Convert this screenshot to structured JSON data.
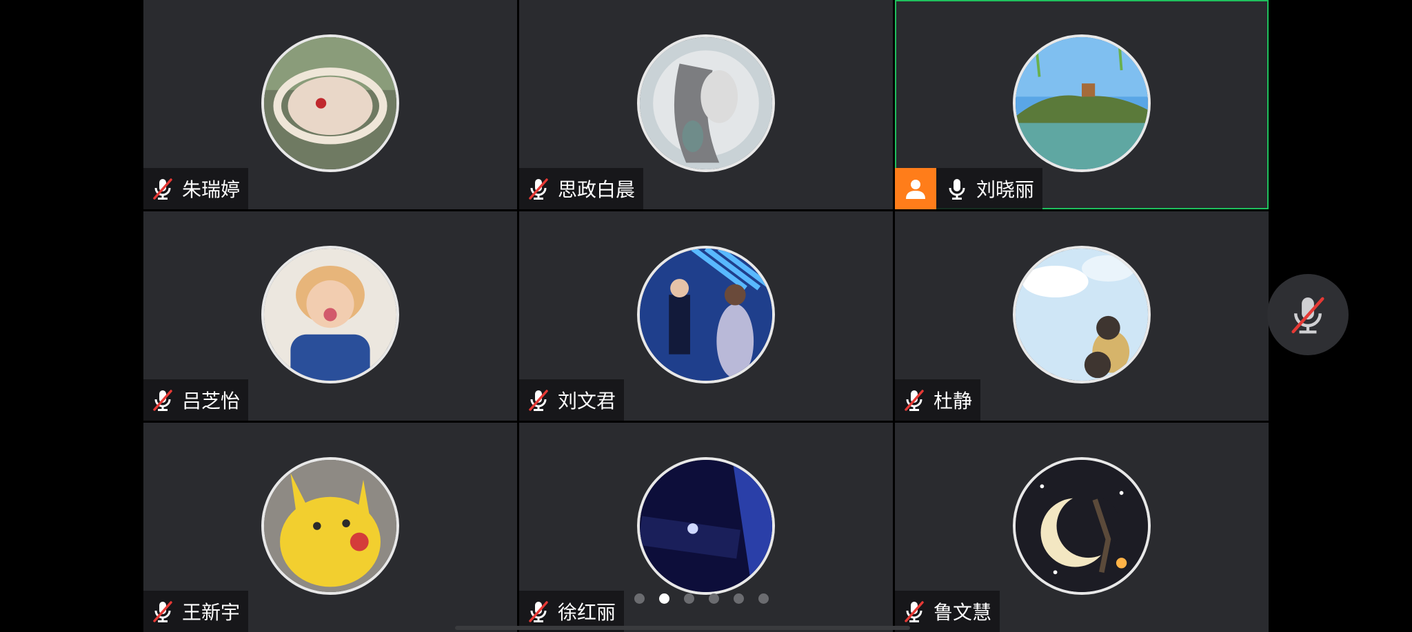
{
  "participants": [
    {
      "name": "朱瑞婷",
      "muted": true,
      "avatar": "woman-portrait-avatar"
    },
    {
      "name": "思政白晨",
      "muted": true,
      "avatar": "sketch-girl-parrot-avatar"
    },
    {
      "name": "刘晓丽",
      "muted": false,
      "host": true,
      "active": true,
      "avatar": "lake-landscape-avatar"
    },
    {
      "name": "吕芝怡",
      "muted": true,
      "avatar": "child-photo-avatar"
    },
    {
      "name": "刘文君",
      "muted": true,
      "avatar": "stage-couple-avatar"
    },
    {
      "name": "杜静",
      "muted": true,
      "avatar": "sky-figure-avatar"
    },
    {
      "name": "王新宇",
      "muted": true,
      "avatar": "pikachu-plush-avatar"
    },
    {
      "name": "徐红丽",
      "muted": true,
      "avatar": "dark-screen-avatar"
    },
    {
      "name": "鲁文慧",
      "muted": true,
      "avatar": "moon-night-avatar"
    }
  ],
  "pager": {
    "count": 6,
    "active_index": 1
  },
  "colors": {
    "active_border": "#1fc05d",
    "host_badge": "#ff7d1a",
    "muted_slash": "#e53935"
  }
}
